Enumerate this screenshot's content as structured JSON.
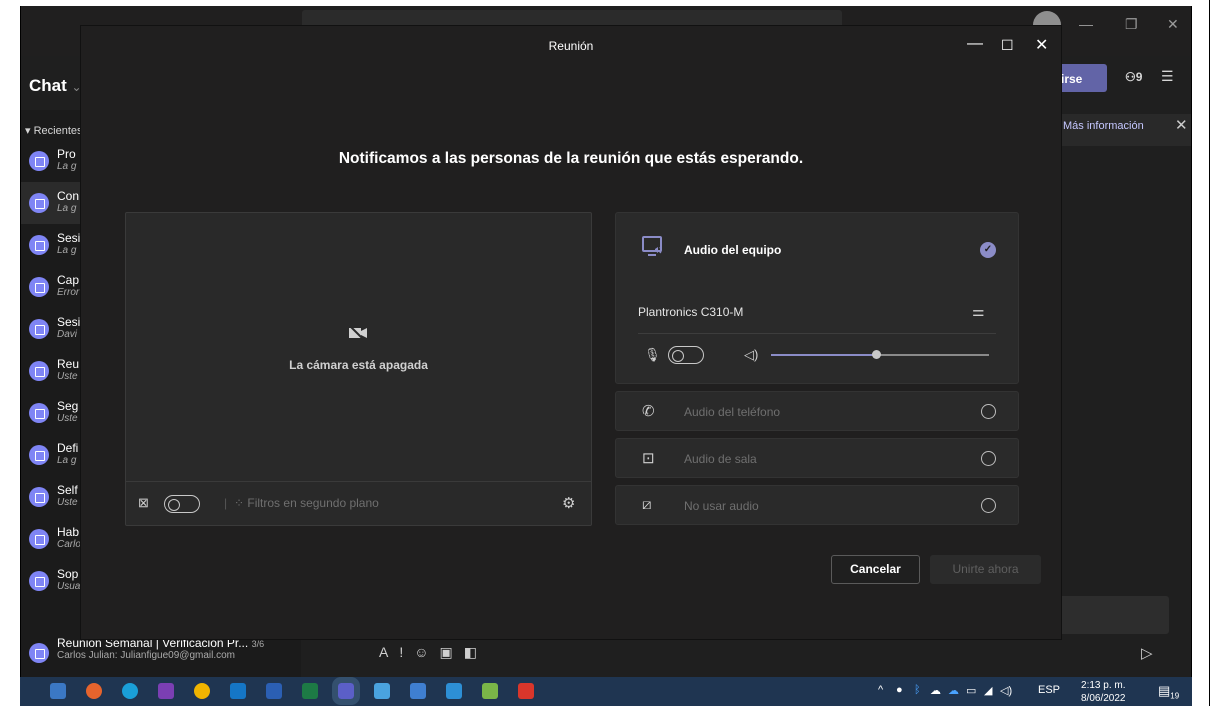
{
  "modal": {
    "title": "Reunión",
    "headline": "Notificamos a las personas de la reunión que estás esperando.",
    "camera_off": "La cámara está apagada",
    "bg_filters": "Filtros en segundo plano",
    "audio_computer": "Audio del equipo",
    "device_name": "Plantronics C310-M",
    "volume_level": 0.48,
    "audio_phone": "Audio del teléfono",
    "audio_room": "Audio de sala",
    "no_audio": "No usar audio",
    "cancel": "Cancelar",
    "join_now": "Unirte ahora"
  },
  "teams": {
    "chat_title": "Chat",
    "recent": "Recientes",
    "join_btn": "irse",
    "participants": "9",
    "more_info": "Más información",
    "chats": [
      {
        "t1": "Pro",
        "t2": "La g"
      },
      {
        "t1": "Con",
        "t2": "La g"
      },
      {
        "t1": "Sesi",
        "t2": "La g"
      },
      {
        "t1": "Cap",
        "t2": "Error"
      },
      {
        "t1": "Sesi",
        "t2": "Davi"
      },
      {
        "t1": "Reu",
        "t2": "Uste"
      },
      {
        "t1": "Seg",
        "t2": "Uste"
      },
      {
        "t1": "Defi",
        "t2": "La g"
      },
      {
        "t1": "Self",
        "t2": "Uste"
      },
      {
        "t1": "Hab",
        "t2": "Carlo"
      },
      {
        "t1": "Sop",
        "t2": "Usua"
      }
    ],
    "last_chat": {
      "t1": "Reunión Semanal | Verificación Pr...",
      "badge": "3/6",
      "t2": "Carlos Julian: Julianfigue09@gmail.com"
    }
  },
  "taskbar": {
    "language": "ESP",
    "time": "2:13 p. m.",
    "date": "8/06/2022",
    "notifications": "19"
  },
  "colors": {
    "accent": "#6264a7",
    "check": "#8b8cc7",
    "taskbar": "#1f3551"
  }
}
